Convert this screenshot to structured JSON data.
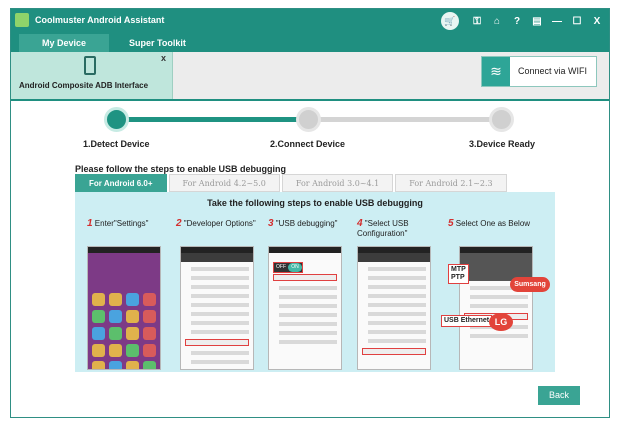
{
  "app": {
    "title": "Coolmuster Android Assistant"
  },
  "titlebar_icons": [
    "cart-icon",
    "key-icon",
    "home-icon",
    "help-icon",
    "feedback-icon",
    "minimize-icon",
    "maximize-icon",
    "close-icon"
  ],
  "titlebar_glyphs": {
    "key": "⚿",
    "home": "⌂",
    "help": "?",
    "feedback": "▤",
    "minimize": "—",
    "maximize": "☐",
    "close": "X",
    "cart": "🛒"
  },
  "tabs": [
    {
      "label": "My Device",
      "active": true
    },
    {
      "label": "Super Toolkit",
      "active": false
    }
  ],
  "device": {
    "name": "Android Composite ADB Interface",
    "close_glyph": "x"
  },
  "wifi": {
    "label": "Connect via WIFI",
    "icon": "wifi-icon",
    "glyph": "≋"
  },
  "steps": [
    {
      "label": "1.Detect Device",
      "state": "active"
    },
    {
      "label": "2.Connect Device",
      "state": "pending"
    },
    {
      "label": "3.Device Ready",
      "state": "pending"
    }
  ],
  "instruction": "Please follow the steps to enable USB debugging",
  "version_tabs": [
    {
      "label": "For Android 6.0+",
      "active": true
    },
    {
      "label": "For Android 4.2~5.0",
      "active": false
    },
    {
      "label": "For Android 3.0~4.1",
      "active": false
    },
    {
      "label": "For Android 2.1~2.3",
      "active": false
    }
  ],
  "panel": {
    "title": "Take the following steps to enable USB debugging",
    "steps": [
      {
        "num": "1",
        "text": "Enter\"Settings\""
      },
      {
        "num": "2",
        "text": "\"Developer Options\""
      },
      {
        "num": "3",
        "text": "\"USB debugging\""
      },
      {
        "num": "4",
        "text": "\"Select USB Configuration\""
      },
      {
        "num": "5",
        "text": "Select One as Below"
      }
    ],
    "toggle": {
      "off": "OFF",
      "on": "ON"
    },
    "tags": {
      "mtp_ptp": "MTP\nPTP",
      "usb_ethernet": "USB Ethernet"
    },
    "bubbles": {
      "samsung": "Sumsang",
      "lg": "LG"
    }
  },
  "colors": {
    "accent": "#1f8f80",
    "tab_active": "#3aa494",
    "panel_bg": "#cdeef3",
    "step_number": "#d32e2e",
    "bubble": "#e2443a"
  },
  "back_button": {
    "label": "Back"
  }
}
